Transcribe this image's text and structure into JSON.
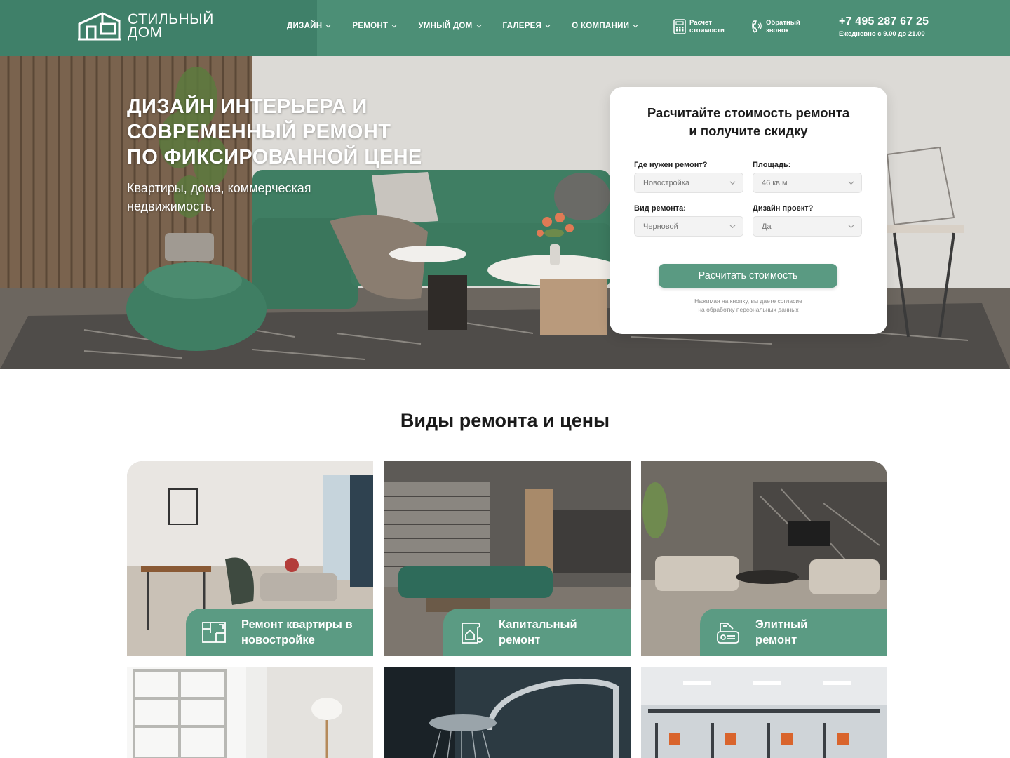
{
  "brand": {
    "line1": "СТИЛЬНЫЙ",
    "line2": "ДОМ"
  },
  "nav": [
    {
      "label": "ДИЗАЙН"
    },
    {
      "label": "РЕМОНТ"
    },
    {
      "label": "УМНЫЙ ДОМ"
    },
    {
      "label": "ГАЛЕРЕЯ"
    },
    {
      "label": "О КОМПАНИИ"
    }
  ],
  "header_actions": {
    "calc": {
      "line1": "Расчет",
      "line2": "стоимости",
      "icon": "calculator-icon"
    },
    "callback": {
      "line1": "Обратный",
      "line2": "звонок",
      "icon": "phone-icon"
    }
  },
  "contact": {
    "phone": "+7 495 287 67 25",
    "hours": "Ежедневно с 9.00 до 21.00"
  },
  "hero": {
    "title_lines": [
      "ДИЗАЙН ИНТЕРЬЕРА И",
      "СОВРЕМЕННЫЙ РЕМОНТ",
      "ПО ФИКСИРОВАННОЙ ЦЕНЕ"
    ],
    "subtitle": "Квартиры, дома, коммерческая недвижимость."
  },
  "calculator": {
    "title_line1": "Расчитайте стоимость ремонта",
    "title_line2": "и получите скидку",
    "fields": [
      {
        "label": "Где нужен ремонт?",
        "value": "Новостройка"
      },
      {
        "label": "Площадь:",
        "value": "46 кв м"
      },
      {
        "label": "Вид ремонта:",
        "value": "Черновой"
      },
      {
        "label": "Дизайн проект?",
        "value": "Да"
      }
    ],
    "button": "Расчитать стоимость",
    "note_line1": "Нажимая на кнопку, вы даете согласие",
    "note_line2": "на обработку персональных данных"
  },
  "section": {
    "title": "Виды ремонта и цены",
    "cards": [
      {
        "line1": "Ремонт квартиры в",
        "line2": "новостройке",
        "icon": "blueprint-icon"
      },
      {
        "line1": "Капитальный",
        "line2": "ремонт",
        "icon": "house-plan-icon"
      },
      {
        "line1": "Элитный",
        "line2": "ремонт",
        "icon": "premium-icon"
      }
    ]
  },
  "colors": {
    "brand_green": "#4c8f76",
    "button_green": "#5a9a82",
    "card_label_green": "#5b9b83"
  }
}
